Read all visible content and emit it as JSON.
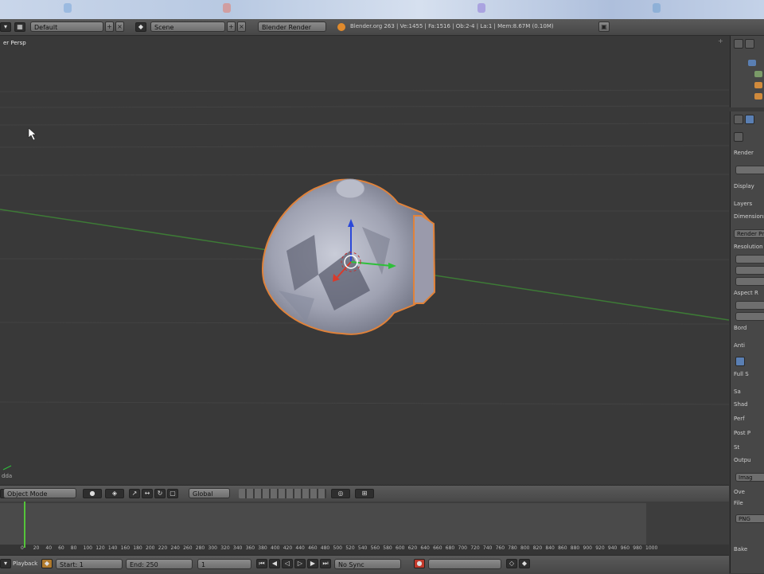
{
  "app": {
    "header": {
      "screen_layout": "Default",
      "scene": "Scene",
      "render_engine": "Blender Render",
      "stats": "Blender.org 263 | Ve:1455 | Fa:1516 | Ob:2-4 | La:1 | Mem:8.67M (0.10M)"
    },
    "viewport": {
      "title": "er Persp",
      "corner_label": "dda"
    },
    "viewport_header": {
      "mode": "Object Mode",
      "orientation": "Global"
    },
    "properties": {
      "rows": [
        "Render",
        "Display",
        "Layers",
        "Dimensions",
        "Render Pr",
        "Resolution",
        "Aspect R",
        "Bord",
        "Anti",
        "Full S",
        "Sa",
        "Shad",
        "Perf",
        "Post P",
        "St",
        "Outpu",
        "Imag",
        "Ove",
        "File",
        "PNG",
        "Bake"
      ]
    },
    "timeline": {
      "ticks": [
        "0",
        "20",
        "40",
        "60",
        "80",
        "100",
        "120",
        "140",
        "160",
        "180",
        "200",
        "220",
        "240",
        "260",
        "280",
        "300",
        "320",
        "340",
        "360",
        "380",
        "400",
        "420",
        "440",
        "460",
        "480",
        "500",
        "520",
        "540",
        "560",
        "580",
        "600",
        "620",
        "640",
        "660",
        "680",
        "700",
        "720",
        "740",
        "760",
        "780",
        "800",
        "820",
        "840",
        "860",
        "880",
        "900",
        "920",
        "940",
        "960",
        "980",
        "1000"
      ],
      "playback_label": "Playback",
      "start": "Start: 1",
      "end": "End: 250",
      "current": "1",
      "sync": "No Sync"
    }
  },
  "colors": {
    "selection_outline": "#e0823a",
    "axis_x": "#d93b2b",
    "axis_y": "#2fbf3a",
    "axis_z": "#2b48d9",
    "playhead": "#55c43a"
  }
}
